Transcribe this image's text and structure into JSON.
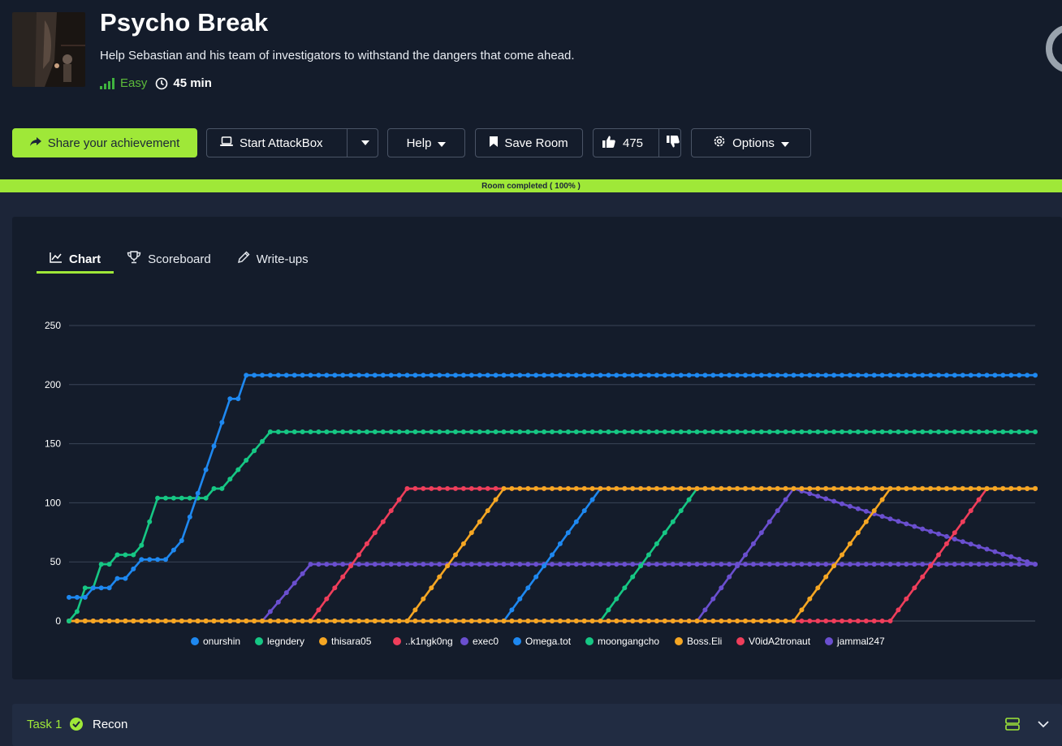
{
  "room": {
    "title": "Psycho Break",
    "description": "Help Sebastian and his team of investigators to withstand the dangers that come ahead.",
    "difficulty": "Easy",
    "duration": "45 min"
  },
  "toolbar": {
    "share_label": "Share your achievement",
    "attackbox_label": "Start AttackBox",
    "help_label": "Help",
    "save_label": "Save Room",
    "likes": "475",
    "options_label": "Options"
  },
  "progress": {
    "label": "Room completed ( 100% )",
    "percent": 100
  },
  "tabs": [
    {
      "label": "Chart",
      "icon": "line-chart-icon",
      "active": true
    },
    {
      "label": "Scoreboard",
      "icon": "trophy-icon",
      "active": false
    },
    {
      "label": "Write-ups",
      "icon": "pencil-icon",
      "active": false
    }
  ],
  "chart_data": {
    "type": "line",
    "title": "",
    "xlabel": "",
    "ylabel": "",
    "ylim": [
      0,
      250
    ],
    "yticks": [
      0,
      50,
      100,
      150,
      200,
      250
    ],
    "grid": true,
    "legend_position": "bottom",
    "points_per_series": 121,
    "series": [
      {
        "name": "onurshin",
        "color": "#1e88f0",
        "keyframes": [
          [
            0,
            20
          ],
          [
            1,
            20
          ],
          [
            2,
            20
          ],
          [
            3,
            28
          ],
          [
            4,
            28
          ],
          [
            5,
            28
          ],
          [
            6,
            36
          ],
          [
            7,
            36
          ],
          [
            8,
            44
          ],
          [
            9,
            52
          ],
          [
            10,
            52
          ],
          [
            11,
            52
          ],
          [
            12,
            52
          ],
          [
            13,
            60
          ],
          [
            14,
            68
          ],
          [
            15,
            88
          ],
          [
            16,
            108
          ],
          [
            17,
            128
          ],
          [
            18,
            148
          ],
          [
            19,
            168
          ],
          [
            20,
            188
          ],
          [
            21,
            188
          ],
          [
            22,
            208
          ],
          [
            120,
            208
          ]
        ]
      },
      {
        "name": "legndery",
        "color": "#16c784",
        "keyframes": [
          [
            0,
            0
          ],
          [
            1,
            8
          ],
          [
            2,
            28
          ],
          [
            3,
            28
          ],
          [
            4,
            48
          ],
          [
            5,
            48
          ],
          [
            6,
            56
          ],
          [
            7,
            56
          ],
          [
            8,
            56
          ],
          [
            9,
            64
          ],
          [
            10,
            84
          ],
          [
            11,
            104
          ],
          [
            12,
            104
          ],
          [
            13,
            104
          ],
          [
            14,
            104
          ],
          [
            15,
            104
          ],
          [
            16,
            104
          ],
          [
            17,
            104
          ],
          [
            18,
            112
          ],
          [
            19,
            112
          ],
          [
            20,
            120
          ],
          [
            21,
            128
          ],
          [
            22,
            136
          ],
          [
            23,
            144
          ],
          [
            24,
            152
          ],
          [
            25,
            160
          ],
          [
            120,
            160
          ]
        ]
      },
      {
        "name": "thisara05",
        "color": "#f5a623",
        "keyframes": [
          [
            0,
            0
          ],
          [
            42,
            0
          ],
          [
            54,
            112
          ],
          [
            120,
            112
          ]
        ]
      },
      {
        "name": "..k1ngk0ng",
        "color": "#ef3e5b",
        "keyframes": [
          [
            0,
            0
          ],
          [
            30,
            0
          ],
          [
            42,
            112
          ],
          [
            120,
            112
          ]
        ]
      },
      {
        "name": "exec0",
        "color": "#6a4fcf",
        "keyframes": [
          [
            0,
            0
          ],
          [
            24,
            0
          ],
          [
            30,
            48
          ],
          [
            120,
            48
          ]
        ]
      },
      {
        "name": "Omega.tot",
        "color": "#1e88f0",
        "keyframes": [
          [
            0,
            0
          ],
          [
            54,
            0
          ],
          [
            66,
            112
          ],
          [
            120,
            112
          ]
        ]
      },
      {
        "name": "moongangcho",
        "color": "#16c784",
        "keyframes": [
          [
            0,
            0
          ],
          [
            66,
            0
          ],
          [
            78,
            112
          ],
          [
            120,
            112
          ]
        ]
      },
      {
        "name": "Boss.Eli",
        "color": "#f5a623",
        "keyframes": [
          [
            0,
            0
          ],
          [
            90,
            0
          ],
          [
            102,
            112
          ],
          [
            120,
            112
          ]
        ]
      },
      {
        "name": "V0idA2tronaut",
        "color": "#ef3e5b",
        "keyframes": [
          [
            0,
            0
          ],
          [
            102,
            0
          ],
          [
            114,
            112
          ],
          [
            120,
            112
          ]
        ]
      },
      {
        "name": "jammal247",
        "color": "#6a4fcf",
        "keyframes": [
          [
            0,
            0
          ],
          [
            78,
            0
          ],
          [
            90,
            112
          ],
          [
            120,
            48
          ]
        ]
      }
    ]
  },
  "task": {
    "number": "Task 1",
    "name": "Recon"
  }
}
